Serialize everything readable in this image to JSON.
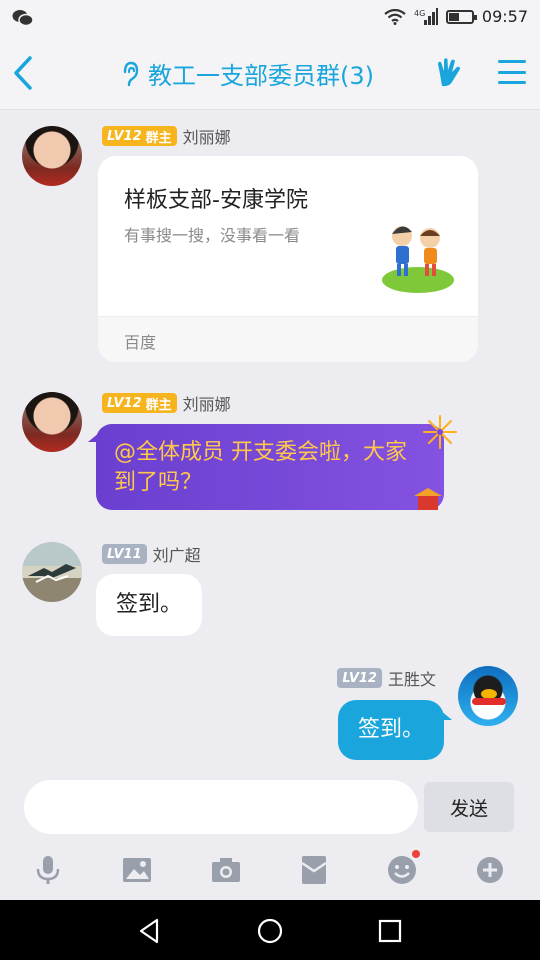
{
  "status_bar": {
    "time": "09:57",
    "icons": [
      "wechat-icon",
      "wifi-icon",
      "signal-icon",
      "battery-icon"
    ]
  },
  "header": {
    "title": "教工一支部委员群(3)",
    "icons": [
      "back-icon",
      "ear-icon",
      "hand-gesture-icon",
      "menu-icon"
    ],
    "accent_color": "#1aa6dd"
  },
  "messages": [
    {
      "sender": "刘丽娜",
      "level": "LV12",
      "role": "群主",
      "type": "share-card",
      "card": {
        "title": "样板支部-安康学院",
        "description": "有事搜一搜，没事看一看",
        "source": "百度"
      }
    },
    {
      "sender": "刘丽娜",
      "level": "LV12",
      "role": "群主",
      "type": "text",
      "text": "@全体成员 开支委会啦，大家到了吗？",
      "bubble_color": "#7a49d8",
      "text_color": "#ffc84a"
    },
    {
      "sender": "刘广超",
      "level": "LV11",
      "type": "text",
      "text": "签到。"
    },
    {
      "sender": "王胜文",
      "level": "LV12",
      "type": "text",
      "self": true,
      "text": "签到。"
    }
  ],
  "input_bar": {
    "placeholder": "",
    "send_label": "发送",
    "tools": [
      "microphone-icon",
      "image-icon",
      "camera-icon",
      "red-packet-icon",
      "emoji-icon",
      "plus-icon"
    ]
  },
  "nav_bar": {
    "icons": [
      "nav-back-icon",
      "nav-home-icon",
      "nav-recents-icon"
    ]
  }
}
